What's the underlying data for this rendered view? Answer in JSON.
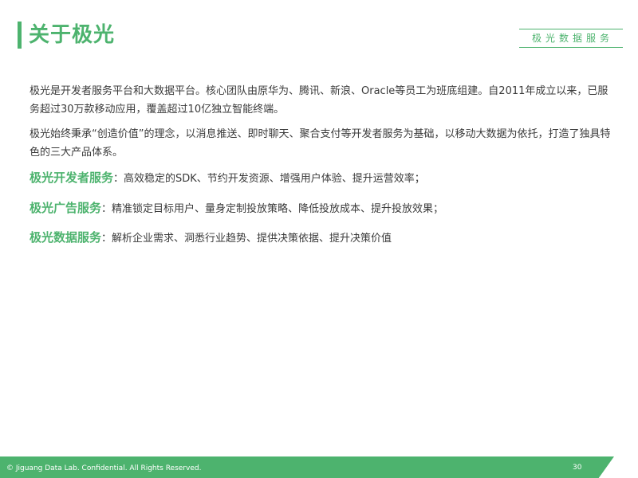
{
  "header": {
    "title": "关于极光",
    "brand_tag": "极光数据服务"
  },
  "intro": {
    "paragraph_1": "极光是开发者服务平台和大数据平台。核心团队由原华为、腾讯、新浪、Oracle等员工为班底组建。自2011年成立以来，已服务超过30万款移动应用，覆盖超过10亿独立智能终端。",
    "paragraph_2": "极光始终秉承“创造价值”的理念，以消息推送、即时聊天、聚合支付等开发者服务为基础，以移动大数据为依托，打造了独具特色的三大产品体系。"
  },
  "services": [
    {
      "name": "极光开发者服务",
      "description": "：高效稳定的SDK、节约开发资源、增强用户体验、提升运营效率；"
    },
    {
      "name": "极光广告服务",
      "description": "：精准锁定目标用户、量身定制投放策略、降低投放成本、提升投放效果；"
    },
    {
      "name": "极光数据服务",
      "description": "：解析企业需求、洞悉行业趋势、提供决策依据、提升决策价值"
    }
  ],
  "footer": {
    "copyright": "© Jiguang Data Lab. Confidential. All Rights Reserved.",
    "page_number": "30"
  },
  "colors": {
    "accent": "#4db36e",
    "text": "#3a3a3a",
    "background": "#ffffff"
  }
}
